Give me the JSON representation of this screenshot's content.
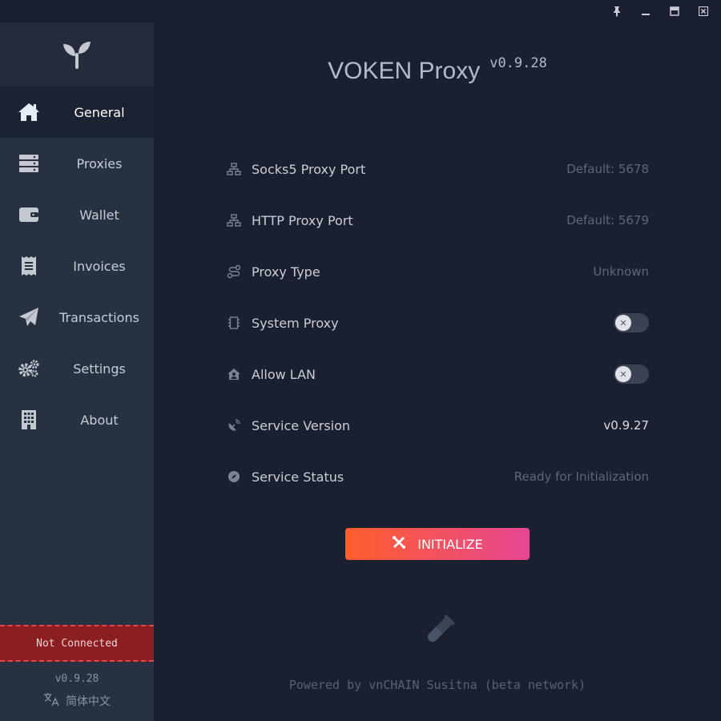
{
  "window": {
    "controls": [
      {
        "name": "pin-icon",
        "symbol": "pin"
      },
      {
        "name": "minimize-icon",
        "symbol": "minimize"
      },
      {
        "name": "maximize-icon",
        "symbol": "maximize"
      },
      {
        "name": "close-icon",
        "symbol": "close"
      }
    ]
  },
  "header": {
    "title": "VOKEN Proxy",
    "version": "v0.9.28"
  },
  "sidebar": {
    "items": [
      {
        "label": "General",
        "icon": "home-icon",
        "active": true
      },
      {
        "label": "Proxies",
        "icon": "server-icon",
        "active": false
      },
      {
        "label": "Wallet",
        "icon": "wallet-icon",
        "active": false
      },
      {
        "label": "Invoices",
        "icon": "receipt-icon",
        "active": false
      },
      {
        "label": "Transactions",
        "icon": "paper-plane-icon",
        "active": false
      },
      {
        "label": "Settings",
        "icon": "gears-icon",
        "active": false
      },
      {
        "label": "About",
        "icon": "building-icon",
        "active": false
      }
    ],
    "connection_status": "Not Connected",
    "version": "v0.9.28",
    "language": "简体中文"
  },
  "settings": {
    "socks5": {
      "label": "Socks5 Proxy Port",
      "value": "Default: 5678"
    },
    "http": {
      "label": "HTTP Proxy Port",
      "value": "Default: 5679"
    },
    "proxy_type": {
      "label": "Proxy Type",
      "value": "Unknown"
    },
    "system_proxy": {
      "label": "System Proxy",
      "enabled": false
    },
    "allow_lan": {
      "label": "Allow LAN",
      "enabled": false
    },
    "service_version": {
      "label": "Service Version",
      "value": "v0.9.27"
    },
    "service_status": {
      "label": "Service Status",
      "value": "Ready for Initialization"
    }
  },
  "actions": {
    "initialize_label": "INITIALIZE"
  },
  "footer": {
    "powered_by": "Powered by vnCHAIN Susitna (beta network)"
  },
  "colors": {
    "accent_start": "#ff5d2c",
    "accent_end": "#e64792",
    "error_bg": "#8a1e22"
  }
}
